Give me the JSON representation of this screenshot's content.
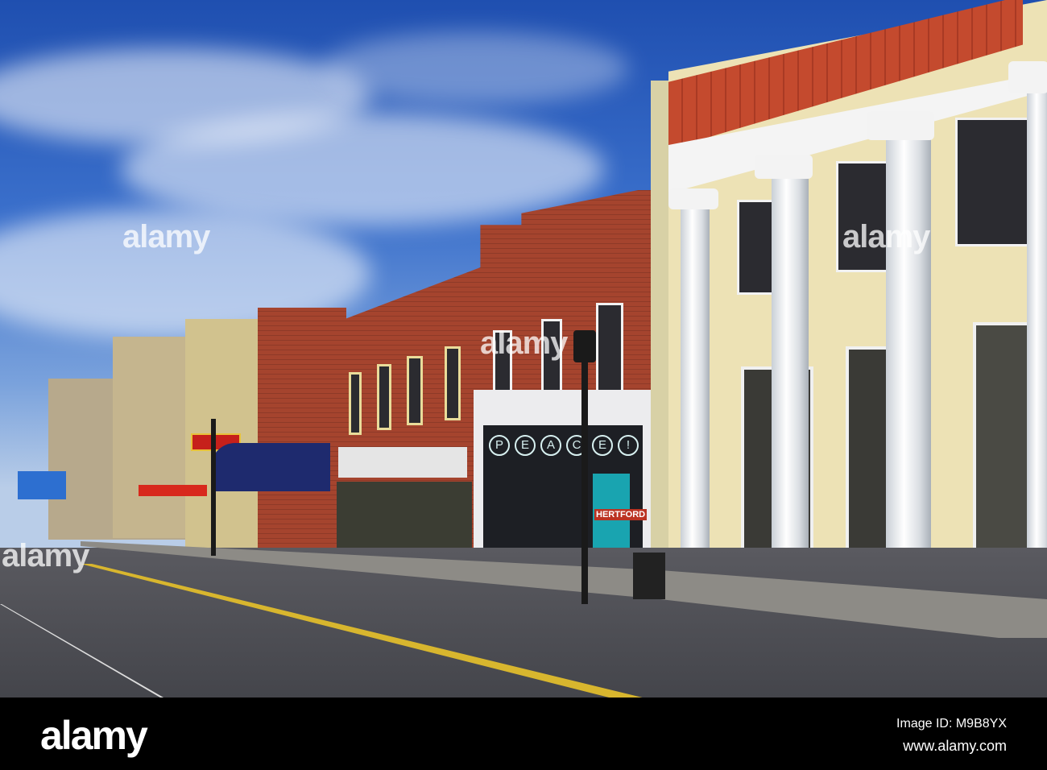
{
  "photo": {
    "subject": "street-scene",
    "storefront_window_letters": [
      "P",
      "E",
      "A",
      "C",
      "E",
      "!"
    ],
    "door_sign": "HERTFORD"
  },
  "watermark": {
    "text": "alamy"
  },
  "footer": {
    "logo": "alamy",
    "image_id": "Image ID: M9B8YX",
    "website": "www.alamy.com"
  }
}
